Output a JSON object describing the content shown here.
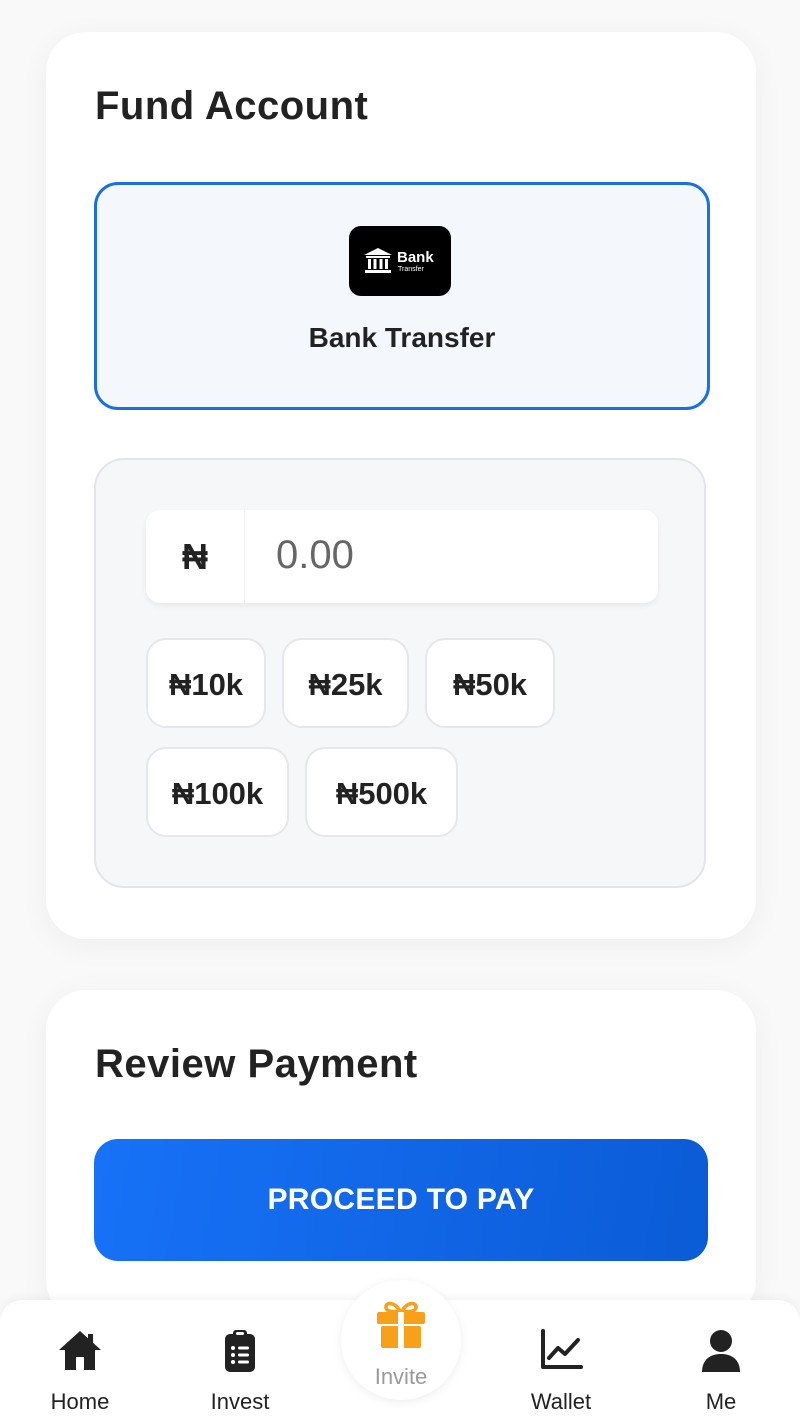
{
  "fund_account": {
    "title": "Fund Account",
    "method": {
      "logo_text": "Bank",
      "logo_subtext": "Transfer",
      "label": "Bank Transfer",
      "icon": "bank-icon"
    },
    "amount": {
      "currency_symbol": "₦",
      "value": "0.00"
    },
    "quick_amounts": [
      "₦10k",
      "₦25k",
      "₦50k",
      "₦100k",
      "₦500k"
    ]
  },
  "review": {
    "title": "Review Payment",
    "proceed_label": "PROCEED TO PAY"
  },
  "nav": {
    "items": [
      {
        "label": "Home",
        "icon": "home-icon"
      },
      {
        "label": "Invest",
        "icon": "clipboard-icon"
      },
      {
        "label": "Invite",
        "icon": "gift-icon"
      },
      {
        "label": "Wallet",
        "icon": "chart-line-icon"
      },
      {
        "label": "Me",
        "icon": "user-icon"
      }
    ]
  },
  "colors": {
    "accent": "#1A6FE3",
    "button_gradient_start": "#1772F7",
    "button_gradient_end": "#0B5BD6",
    "gift": "#F7A11A",
    "method_background": "#F4F8FD"
  }
}
